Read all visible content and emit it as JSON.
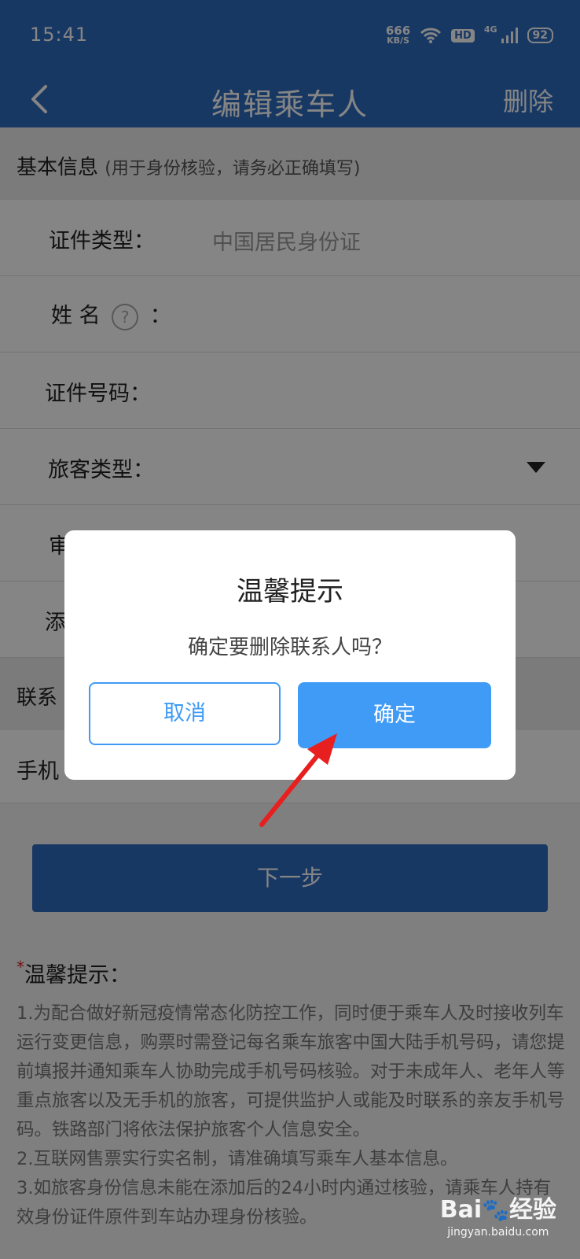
{
  "status_bar": {
    "time": "15:41",
    "net_speed_value": "666",
    "net_speed_unit": "KB/S",
    "hd_badge": "HD",
    "signal_label": "4G",
    "battery": "92"
  },
  "header": {
    "title": "编辑乘车人",
    "action": "删除"
  },
  "basic_section": {
    "title": "基本信息",
    "subtitle": "(用于身份核验，请务必正确填写)"
  },
  "form_rows": [
    {
      "label": "证件类型：",
      "value": "中国居民身份证"
    },
    {
      "label": "姓 名",
      "suffix": "：",
      "help": "?"
    },
    {
      "label": "证件号码："
    },
    {
      "label": "旅客类型："
    },
    {
      "label": "审"
    },
    {
      "label": "添"
    }
  ],
  "contact_section": {
    "title": "联系"
  },
  "phone_row": {
    "label": "手机"
  },
  "next_button": "下一步",
  "tips": {
    "star": "*",
    "title": "温馨提示：",
    "items": [
      "1.为配合做好新冠疫情常态化防控工作，同时便于乘车人及时接收列车运行变更信息，购票时需登记每名乘车旅客中国大陆手机号码，请您提前填报并通知乘车人协助完成手机号码核验。对于未成年人、老年人等重点旅客以及无手机的旅客，可提供监护人或能及时联系的亲友手机号码。铁路部门将依法保护旅客个人信息安全。",
      "2.互联网售票实行实名制，请准确填写乘车人基本信息。",
      "3.如旅客身份信息未能在添加后的24小时内通过核验，请乘车人持有效身份证件原件到车站办理身份核验。"
    ]
  },
  "dialog": {
    "title": "温馨提示",
    "message": "确定要删除联系人吗？",
    "cancel": "取消",
    "confirm": "确定"
  },
  "watermark": {
    "logo_left": "Bai",
    "logo_right": "经验",
    "url": "jingyan.baidu.com"
  },
  "colors": {
    "header_blue": "#2f6cc0",
    "dialog_accent": "#3f9bf5",
    "arrow_red": "#e81f1f"
  }
}
